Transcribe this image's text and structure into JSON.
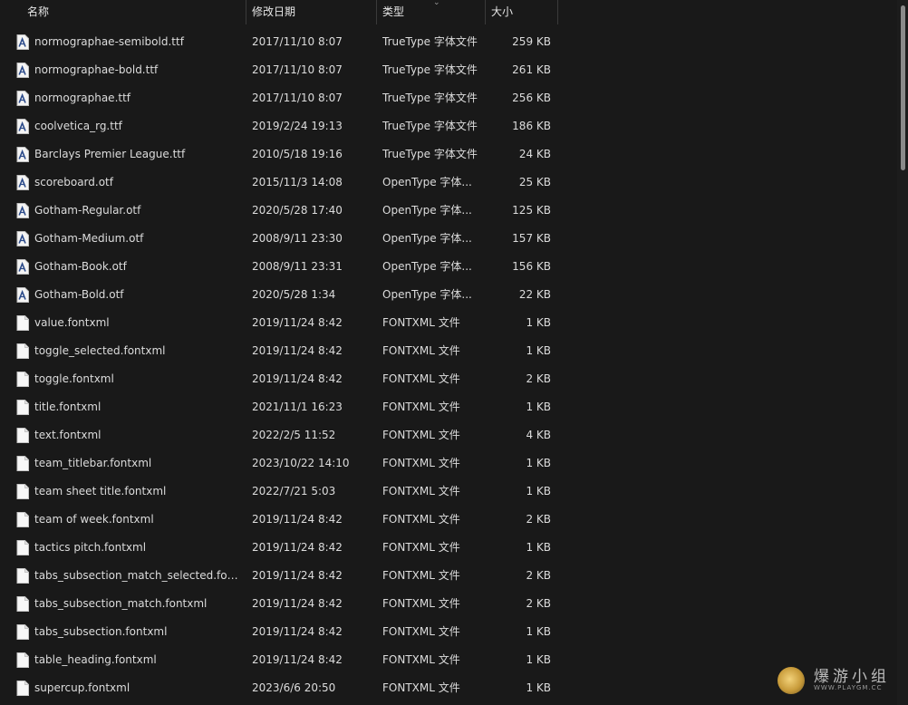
{
  "columns": {
    "name": "名称",
    "date": "修改日期",
    "type": "类型",
    "size": "大小"
  },
  "files": [
    {
      "name": "normographae-semibold.ttf",
      "date": "2017/11/10 8:07",
      "type": "TrueType 字体文件",
      "size": "259 KB",
      "icon": "font-file-icon"
    },
    {
      "name": "normographae-bold.ttf",
      "date": "2017/11/10 8:07",
      "type": "TrueType 字体文件",
      "size": "261 KB",
      "icon": "font-file-icon"
    },
    {
      "name": "normographae.ttf",
      "date": "2017/11/10 8:07",
      "type": "TrueType 字体文件",
      "size": "256 KB",
      "icon": "font-file-icon"
    },
    {
      "name": "coolvetica_rg.ttf",
      "date": "2019/2/24 19:13",
      "type": "TrueType 字体文件",
      "size": "186 KB",
      "icon": "font-file-icon"
    },
    {
      "name": "Barclays Premier League.ttf",
      "date": "2010/5/18 19:16",
      "type": "TrueType 字体文件",
      "size": "24 KB",
      "icon": "font-file-icon"
    },
    {
      "name": "scoreboard.otf",
      "date": "2015/11/3 14:08",
      "type": "OpenType 字体...",
      "size": "25 KB",
      "icon": "font-file-icon"
    },
    {
      "name": "Gotham-Regular.otf",
      "date": "2020/5/28 17:40",
      "type": "OpenType 字体...",
      "size": "125 KB",
      "icon": "font-file-icon"
    },
    {
      "name": "Gotham-Medium.otf",
      "date": "2008/9/11 23:30",
      "type": "OpenType 字体...",
      "size": "157 KB",
      "icon": "font-file-icon"
    },
    {
      "name": "Gotham-Book.otf",
      "date": "2008/9/11 23:31",
      "type": "OpenType 字体...",
      "size": "156 KB",
      "icon": "font-file-icon"
    },
    {
      "name": "Gotham-Bold.otf",
      "date": "2020/5/28 1:34",
      "type": "OpenType 字体...",
      "size": "22 KB",
      "icon": "font-file-icon"
    },
    {
      "name": "value.fontxml",
      "date": "2019/11/24 8:42",
      "type": "FONTXML 文件",
      "size": "1 KB",
      "icon": "blank-file-icon"
    },
    {
      "name": "toggle_selected.fontxml",
      "date": "2019/11/24 8:42",
      "type": "FONTXML 文件",
      "size": "1 KB",
      "icon": "blank-file-icon"
    },
    {
      "name": "toggle.fontxml",
      "date": "2019/11/24 8:42",
      "type": "FONTXML 文件",
      "size": "2 KB",
      "icon": "blank-file-icon"
    },
    {
      "name": "title.fontxml",
      "date": "2021/11/1 16:23",
      "type": "FONTXML 文件",
      "size": "1 KB",
      "icon": "blank-file-icon"
    },
    {
      "name": "text.fontxml",
      "date": "2022/2/5 11:52",
      "type": "FONTXML 文件",
      "size": "4 KB",
      "icon": "blank-file-icon"
    },
    {
      "name": "team_titlebar.fontxml",
      "date": "2023/10/22 14:10",
      "type": "FONTXML 文件",
      "size": "1 KB",
      "icon": "blank-file-icon"
    },
    {
      "name": "team sheet title.fontxml",
      "date": "2022/7/21 5:03",
      "type": "FONTXML 文件",
      "size": "1 KB",
      "icon": "blank-file-icon"
    },
    {
      "name": "team of week.fontxml",
      "date": "2019/11/24 8:42",
      "type": "FONTXML 文件",
      "size": "2 KB",
      "icon": "blank-file-icon"
    },
    {
      "name": "tactics pitch.fontxml",
      "date": "2019/11/24 8:42",
      "type": "FONTXML 文件",
      "size": "1 KB",
      "icon": "blank-file-icon"
    },
    {
      "name": "tabs_subsection_match_selected.fontx...",
      "date": "2019/11/24 8:42",
      "type": "FONTXML 文件",
      "size": "2 KB",
      "icon": "blank-file-icon"
    },
    {
      "name": "tabs_subsection_match.fontxml",
      "date": "2019/11/24 8:42",
      "type": "FONTXML 文件",
      "size": "2 KB",
      "icon": "blank-file-icon"
    },
    {
      "name": "tabs_subsection.fontxml",
      "date": "2019/11/24 8:42",
      "type": "FONTXML 文件",
      "size": "1 KB",
      "icon": "blank-file-icon"
    },
    {
      "name": "table_heading.fontxml",
      "date": "2019/11/24 8:42",
      "type": "FONTXML 文件",
      "size": "1 KB",
      "icon": "blank-file-icon"
    },
    {
      "name": "supercup.fontxml",
      "date": "2023/6/6 20:50",
      "type": "FONTXML 文件",
      "size": "1 KB",
      "icon": "blank-file-icon"
    }
  ],
  "watermark": {
    "text": "爆游小组",
    "sub": "WWW.PLAYGM.CC"
  }
}
